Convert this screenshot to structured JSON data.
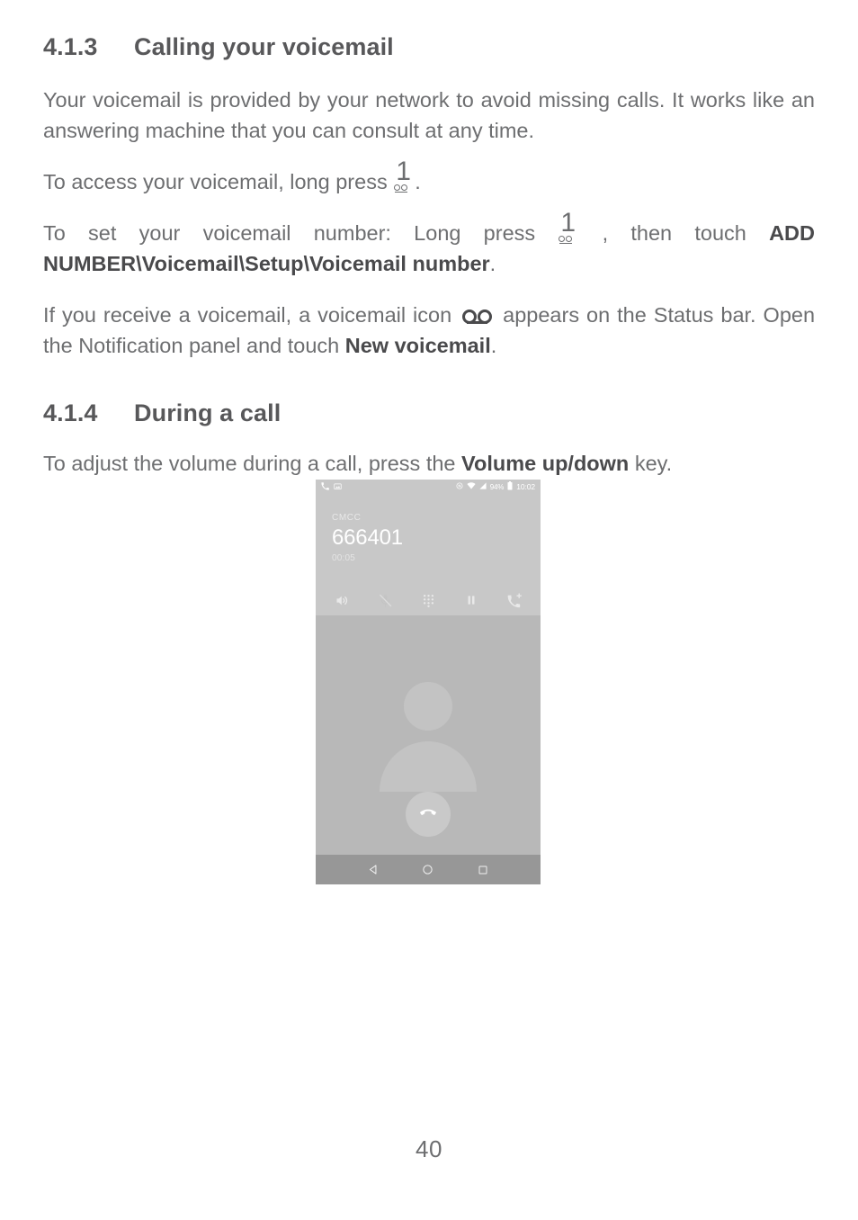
{
  "document": {
    "page_number": "40"
  },
  "sections": [
    {
      "number": "4.1.3",
      "title": "Calling your voicemail"
    },
    {
      "number": "4.1.4",
      "title": "During a call"
    }
  ],
  "paragraphs": {
    "p1": "Your voicemail is provided by your network to avoid missing calls. It works like an answering machine that you can consult at any time.",
    "p2_a": "To access your voicemail, long press",
    "p2_b": ".",
    "p3_a": "To set your voicemail number: Long press",
    "p3_b": ", then touch",
    "p3_bold": "ADD NUMBER\\Voicemail\\Setup\\Voicemail number",
    "p3_c": ".",
    "p4_a": "If you receive a voicemail, a voicemail icon",
    "p4_b": "appears on the Status bar. Open the Notification panel and touch",
    "p4_bold": "New voicemail",
    "p4_c": ".",
    "p5_a": "To adjust the volume during a call, press the",
    "p5_bold": "Volume up/down",
    "p5_b": "key."
  },
  "phone_screenshot": {
    "status_bar": {
      "left_icons": [
        "phone-call-icon",
        "screenshot-image-icon"
      ],
      "vibrate_icon": "vibrate-mode-icon",
      "wifi_icon": "wifi-icon",
      "signal_icon": "cellular-signal-icon",
      "battery_percent": "94%",
      "battery_icon": "battery-icon",
      "clock": "10:02"
    },
    "call": {
      "carrier": "CMCC",
      "number": "666401",
      "duration": "00:05"
    },
    "actions": [
      {
        "name": "speaker-icon",
        "label": "Speaker"
      },
      {
        "name": "mute-microphone-icon",
        "label": "Mute"
      },
      {
        "name": "dialpad-icon",
        "label": "Dialpad"
      },
      {
        "name": "hold-pause-icon",
        "label": "Hold"
      },
      {
        "name": "add-call-icon",
        "label": "Add call"
      }
    ],
    "end_call": {
      "name": "end-call-icon",
      "label": "End call"
    },
    "nav_bar": [
      {
        "name": "nav-back-icon",
        "label": "Back"
      },
      {
        "name": "nav-home-icon",
        "label": "Home"
      },
      {
        "name": "nav-recents-icon",
        "label": "Recents"
      }
    ]
  },
  "colors": {
    "text": "#6d6e70",
    "heading": "#58585a",
    "bold": "#4a4a4c",
    "phone_body": "#b8b8b8",
    "phone_top": "#c8c8c8",
    "nav_bar": "#979797",
    "avatar": "#c3c3c3"
  }
}
